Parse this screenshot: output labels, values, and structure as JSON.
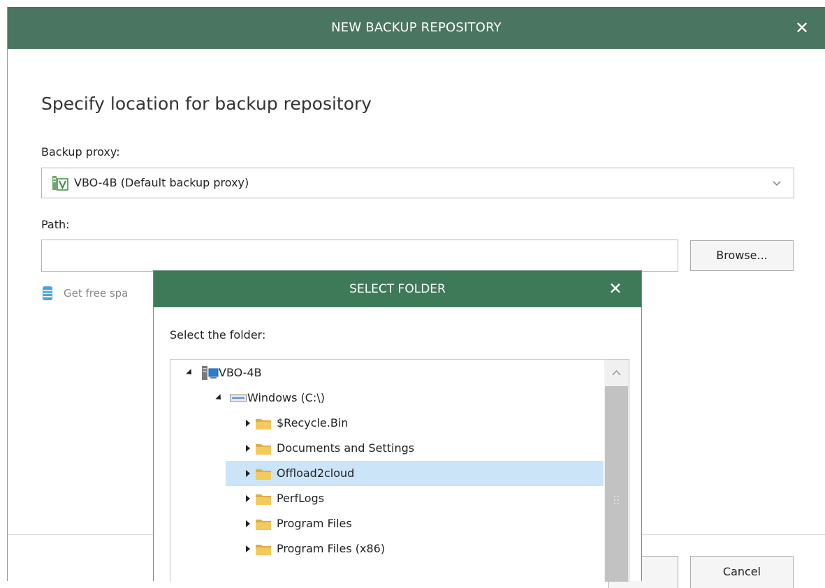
{
  "main_dialog": {
    "title": "NEW BACKUP REPOSITORY",
    "heading": "Specify location for backup repository",
    "backup_proxy_label": "Backup proxy:",
    "backup_proxy_value": "VBO-4B (Default backup proxy)",
    "path_label": "Path:",
    "path_value": "",
    "browse_label": "Browse...",
    "free_space_text": "Get free spa",
    "cancel_label": "Cancel"
  },
  "select_folder": {
    "title": "SELECT FOLDER",
    "prompt": "Select the folder:",
    "tree": [
      {
        "label": "VBO-4B",
        "icon": "server-icon",
        "expanded": true
      },
      {
        "label": "Windows (C:\\)",
        "icon": "drive-icon",
        "expanded": true
      },
      {
        "label": "$Recycle.Bin",
        "icon": "folder-icon",
        "expanded": false
      },
      {
        "label": "Documents and Settings",
        "icon": "folder-icon",
        "expanded": false
      },
      {
        "label": "Offload2cloud",
        "icon": "folder-icon",
        "expanded": false,
        "selected": true
      },
      {
        "label": "PerfLogs",
        "icon": "folder-icon",
        "expanded": false
      },
      {
        "label": "Program Files",
        "icon": "folder-icon",
        "expanded": false
      },
      {
        "label": "Program Files (x86)",
        "icon": "folder-icon",
        "expanded": false
      }
    ]
  },
  "colors": {
    "titlebar": "#4a7560",
    "select_titlebar": "#3f7a58",
    "selection": "#cce4f7",
    "folder": "#f4c95d"
  }
}
